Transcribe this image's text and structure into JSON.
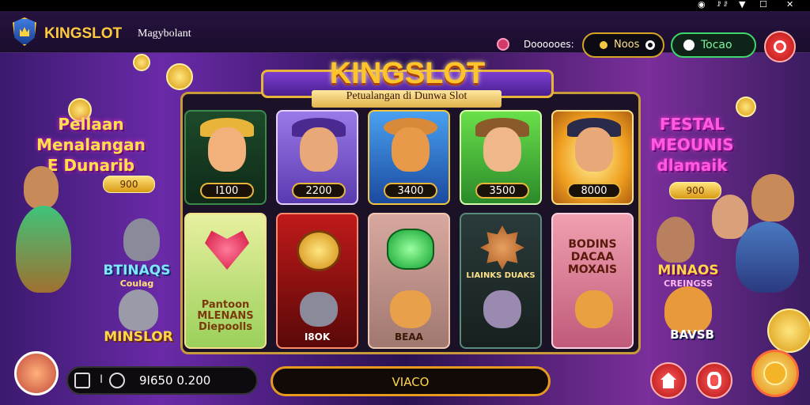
{
  "system_bar": {
    "status_text": "ꗗ ꗗ"
  },
  "header": {
    "brand": "KINGSLOT",
    "subtitle": "Magybolant",
    "notification_text": "Doooooes:",
    "balance": "Noos",
    "deposit_label": "Tocao"
  },
  "banner": {
    "title": "KINGSLOT",
    "subtitle": "Petualangan di Dunwa Slot"
  },
  "left_panel": {
    "title_lines": [
      "Pellaan",
      "Menalangan",
      "E Dunarib"
    ],
    "badge": "900",
    "sub_title": "BTINAQS",
    "sub_caption": "Coulag",
    "bottom_label": "MINSLOR"
  },
  "right_panel": {
    "title_lines": [
      "FESTAL",
      "MEOUNIS",
      "dlamaik"
    ],
    "badge": "900",
    "sub_title": "MINAOS",
    "sub_caption": "CREINGSS",
    "bottom_label": "BAVSB"
  },
  "row1_tiles": [
    {
      "value": "I100"
    },
    {
      "value": "2200"
    },
    {
      "value": "3400"
    },
    {
      "value": "3500"
    },
    {
      "value": "8000"
    }
  ],
  "row2_tiles": [
    {
      "label": "Pantoon MLENANS Diepoolls"
    },
    {
      "label": "I8OK"
    },
    {
      "label": "BEAA"
    },
    {
      "label": "LIAINKS DUAKS"
    },
    {
      "label": "BODINS DACAA MOXAIS"
    }
  ],
  "bottom": {
    "wallet_index": "I",
    "wallet_value": "9I650 0.200",
    "spin_label": "VIACO"
  }
}
